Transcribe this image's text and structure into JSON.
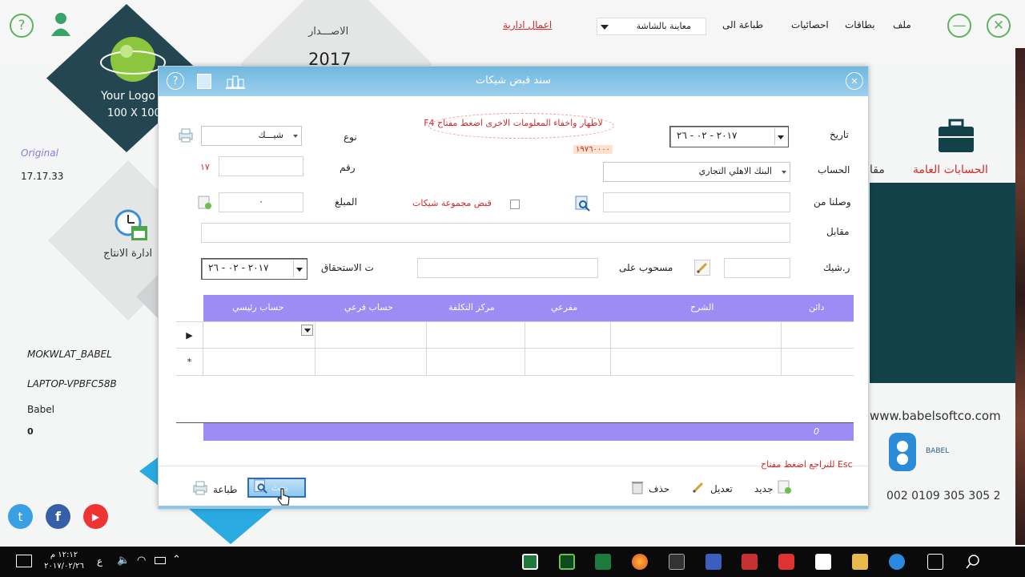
{
  "app": {
    "menu": {
      "file": "ملف",
      "cards": "بطاقات",
      "stats": "احصائيات",
      "print_to": "طباعة الى",
      "screen_preview": "معاينة بالشاشة",
      "admin_work": "اعمال ادارية"
    },
    "release": {
      "label": "الاصـــدار",
      "year": "2017"
    },
    "logo": {
      "line1": "Your Logo",
      "line2": "100 X 100"
    },
    "info": {
      "original": "Original",
      "version": "17.17.33",
      "user": "MOKWLAT_BABEL",
      "machine": "LAPTOP-VPBFC58B",
      "company": "Babel",
      "zero": "0"
    },
    "tiles": {
      "production": "ادارة الانتاج",
      "general_accounts": "الحسابات العامة",
      "partial": "مقا"
    },
    "website": "www.babelsoftco.com",
    "phone": "002 0109 305 305 2",
    "babel_brand": "BABEL"
  },
  "dialog": {
    "title": "سند قبض شيكات",
    "hint": "لاظهار واخفاء المعلومات الاخرى اضغط مفتاح F4",
    "amount_red": "١٩٧٦٠٠٠٠",
    "labels": {
      "date": "تاريخ",
      "account": "الحساب",
      "received_from": "وصلنا من",
      "against": "مقابل",
      "cheque_no": "ر.شيك",
      "drawn_on": "مسحوب على",
      "due_date": "ت الاستحقاق",
      "type": "نوع",
      "number": "رقم",
      "amount": "المبلغ",
      "receive_group": "قبض مجموعة شيكات"
    },
    "values": {
      "date": "٢٠١٧ - ٠٢ - ٢٦",
      "account": "البنك الاهلي التجاري",
      "type": "شيـــك",
      "number": "١٧",
      "amount": "٠",
      "due_date": "٢٠١٧ - ٠٢ - ٢٦"
    },
    "grid": {
      "columns": [
        "دائن",
        "الشرح",
        "مفرعي",
        "مركز التكلفة",
        "حساب فرعي",
        "حساب رئيسي"
      ],
      "row_markers": [
        "▶",
        "*"
      ],
      "total": "0"
    },
    "esc_hint": "للتراجع اضغط مفتاح Esc",
    "buttons": {
      "new": "جديد",
      "edit": "تعديل",
      "delete": "حذف",
      "print": "طباعة",
      "search": "بحث"
    }
  },
  "taskbar": {
    "time": "١٢:١٢ م",
    "date": "٢٠١٧/٠٢/٢٦",
    "lang": "ع"
  },
  "colors": {
    "accent": "#9d8cf3",
    "teal": "#12414a",
    "title_bar": "#8ec6e8",
    "red_text": "#d42a2a"
  }
}
